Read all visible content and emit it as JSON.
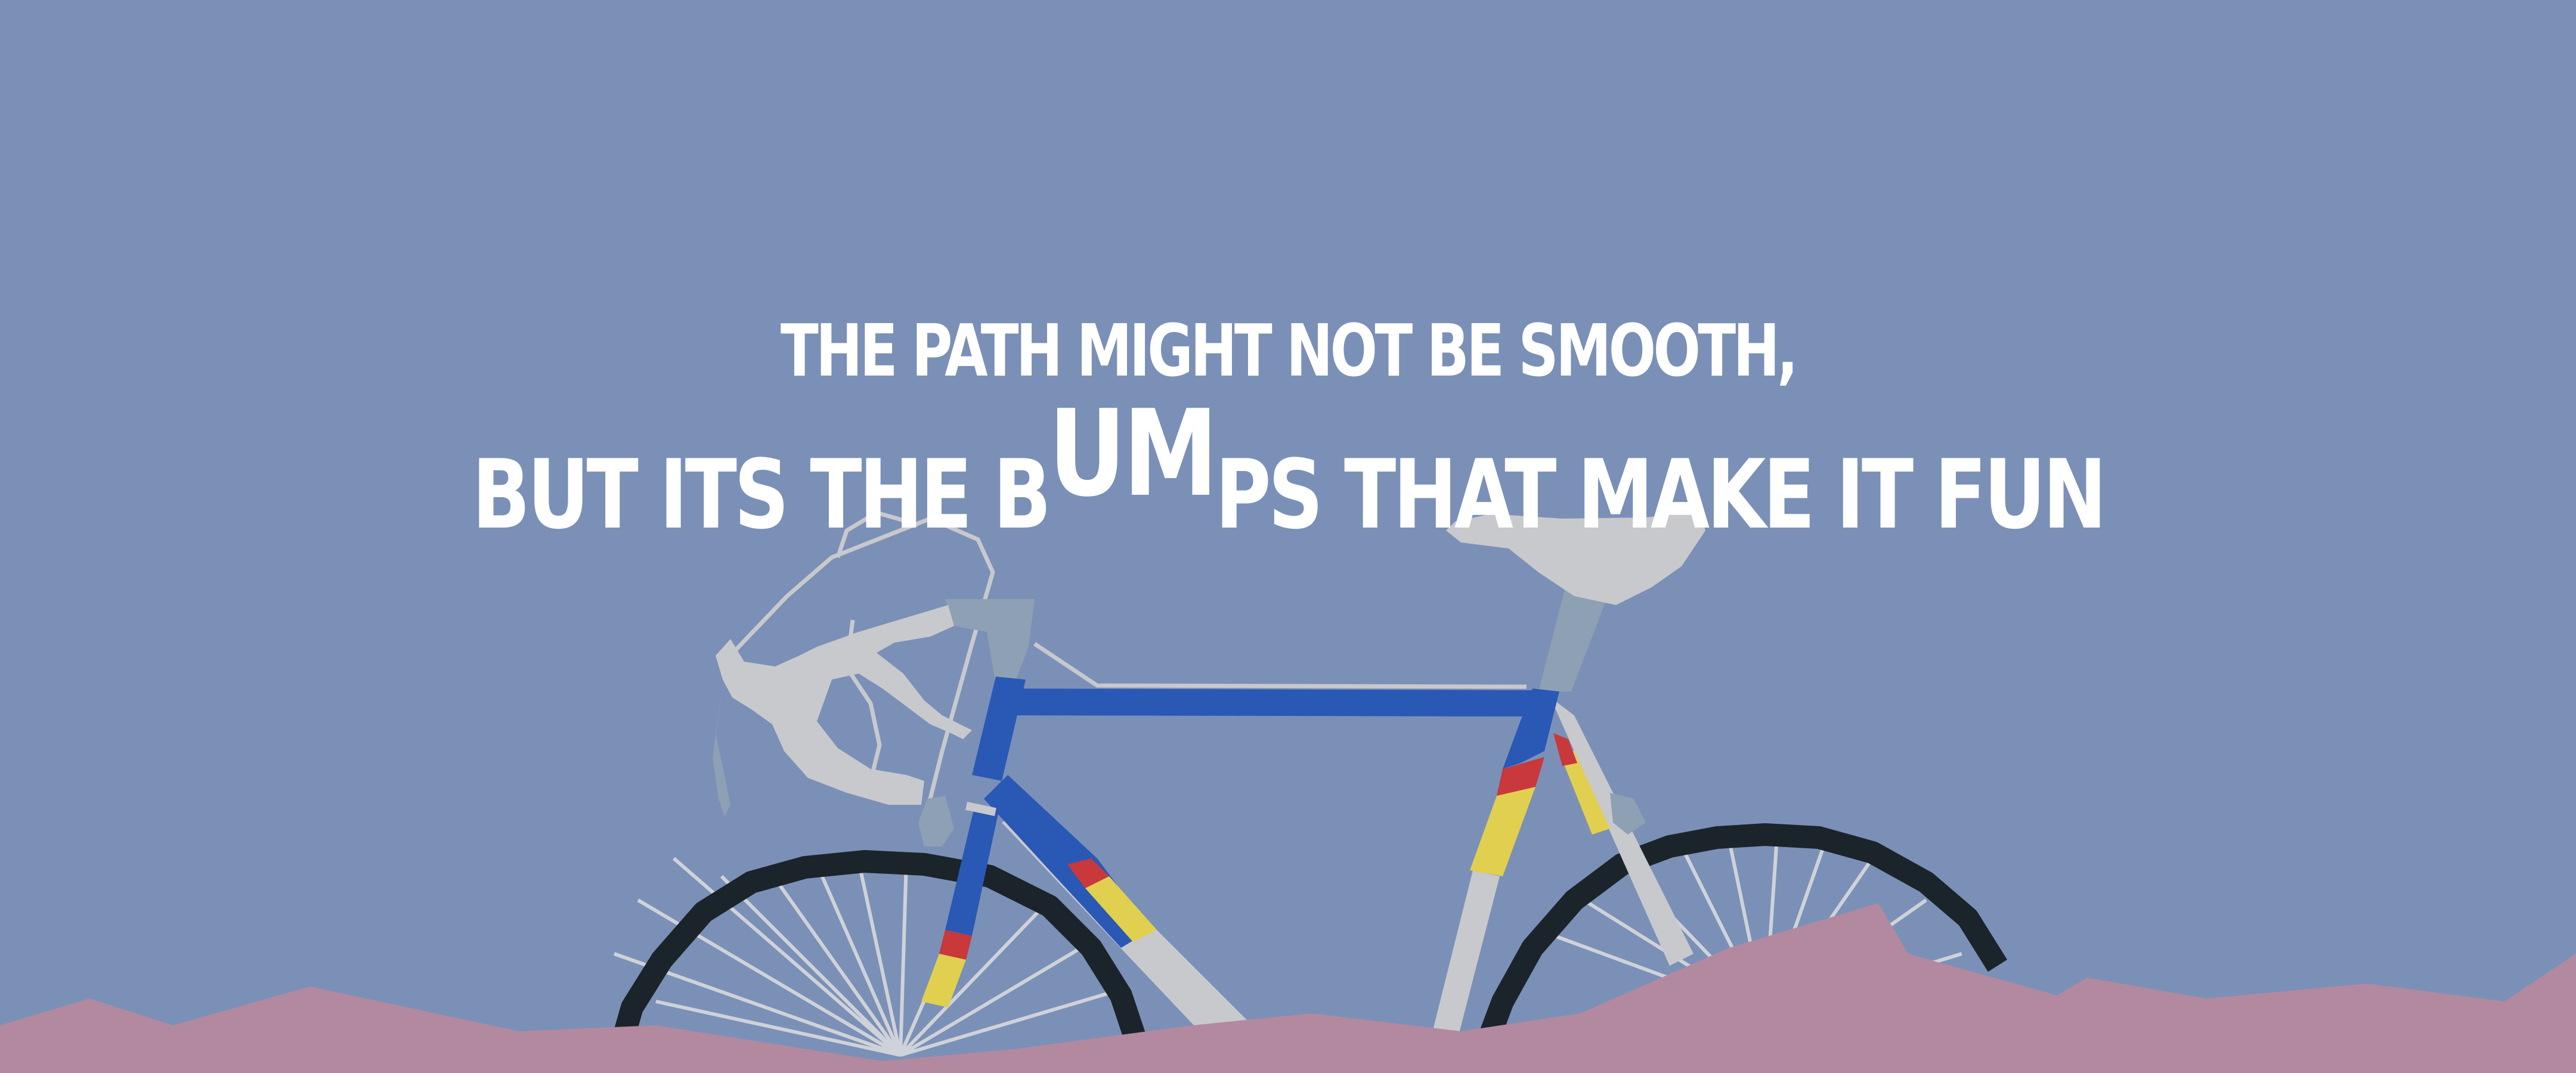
{
  "quote": {
    "line1": "THE PATH MIGHT NOT BE SMOOTH,",
    "line2_before": "BUT ITS THE B",
    "line2_bump": "UM",
    "line2_after": "PS THAT MAKE IT FUN"
  },
  "colors": {
    "sky": "#7b90b7",
    "ground": "#b389a0",
    "frame_blue": "#2a58b5",
    "tire": "#1b242a",
    "light_gray": "#c8c9cd",
    "stripe_red": "#c9383b",
    "stripe_yellow": "#e1cf4f",
    "slate": "#8ea0b3"
  }
}
